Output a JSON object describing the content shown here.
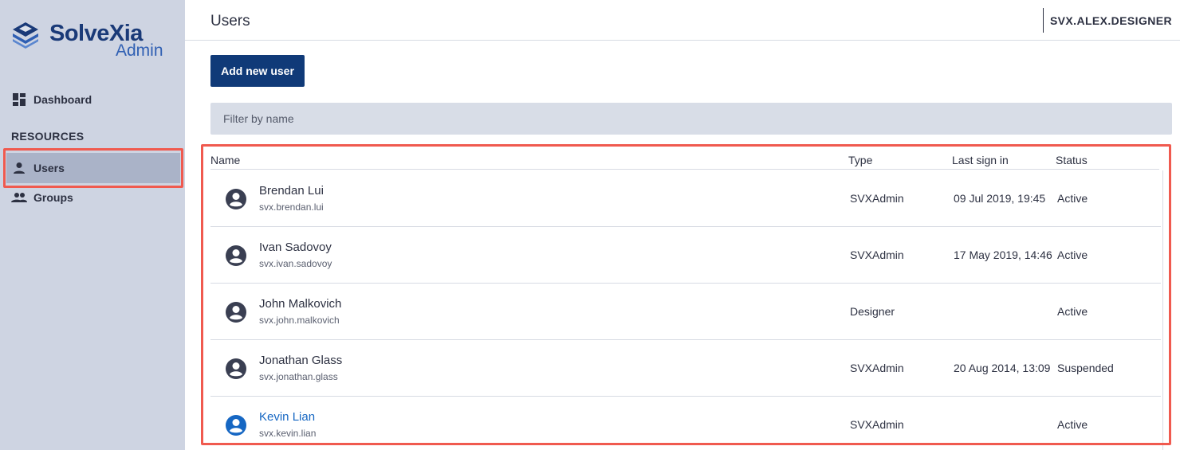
{
  "app": {
    "logo_name": "SolveXia",
    "logo_sub": "Admin"
  },
  "colors": {
    "sidebar_bg": "#ced4e2",
    "brand": "#103a78",
    "active_nav": "#aab3c8",
    "highlight": "#f05a4f",
    "selected_text": "#1667c3"
  },
  "sidebar": {
    "dashboard": {
      "label": "Dashboard",
      "icon": "dashboard-icon"
    },
    "section_label": "RESOURCES",
    "users": {
      "label": "Users",
      "icon": "person-icon",
      "active": true
    },
    "groups": {
      "label": "Groups",
      "icon": "people-icon"
    }
  },
  "header": {
    "title": "Users",
    "current_user": "SVX.ALEX.DESIGNER"
  },
  "toolbar": {
    "add_label": "Add new user",
    "filter_placeholder": "Filter by name"
  },
  "table": {
    "columns": {
      "name": "Name",
      "type": "Type",
      "last": "Last sign in",
      "status": "Status"
    },
    "rows": [
      {
        "name": "Brendan Lui",
        "login": "svx.brendan.lui",
        "type": "SVXAdmin",
        "last": "09 Jul 2019, 19:45",
        "status": "Active",
        "selected": false
      },
      {
        "name": "Ivan Sadovoy",
        "login": "svx.ivan.sadovoy",
        "type": "SVXAdmin",
        "last": "17 May 2019, 14:46",
        "status": "Active",
        "selected": false
      },
      {
        "name": "John Malkovich",
        "login": "svx.john.malkovich",
        "type": "Designer",
        "last": "",
        "status": "Active",
        "selected": false
      },
      {
        "name": "Jonathan Glass",
        "login": "svx.jonathan.glass",
        "type": "SVXAdmin",
        "last": "20 Aug 2014, 13:09",
        "status": "Suspended",
        "selected": false
      },
      {
        "name": "Kevin Lian",
        "login": "svx.kevin.lian",
        "type": "SVXAdmin",
        "last": "",
        "status": "Active",
        "selected": true
      }
    ]
  }
}
